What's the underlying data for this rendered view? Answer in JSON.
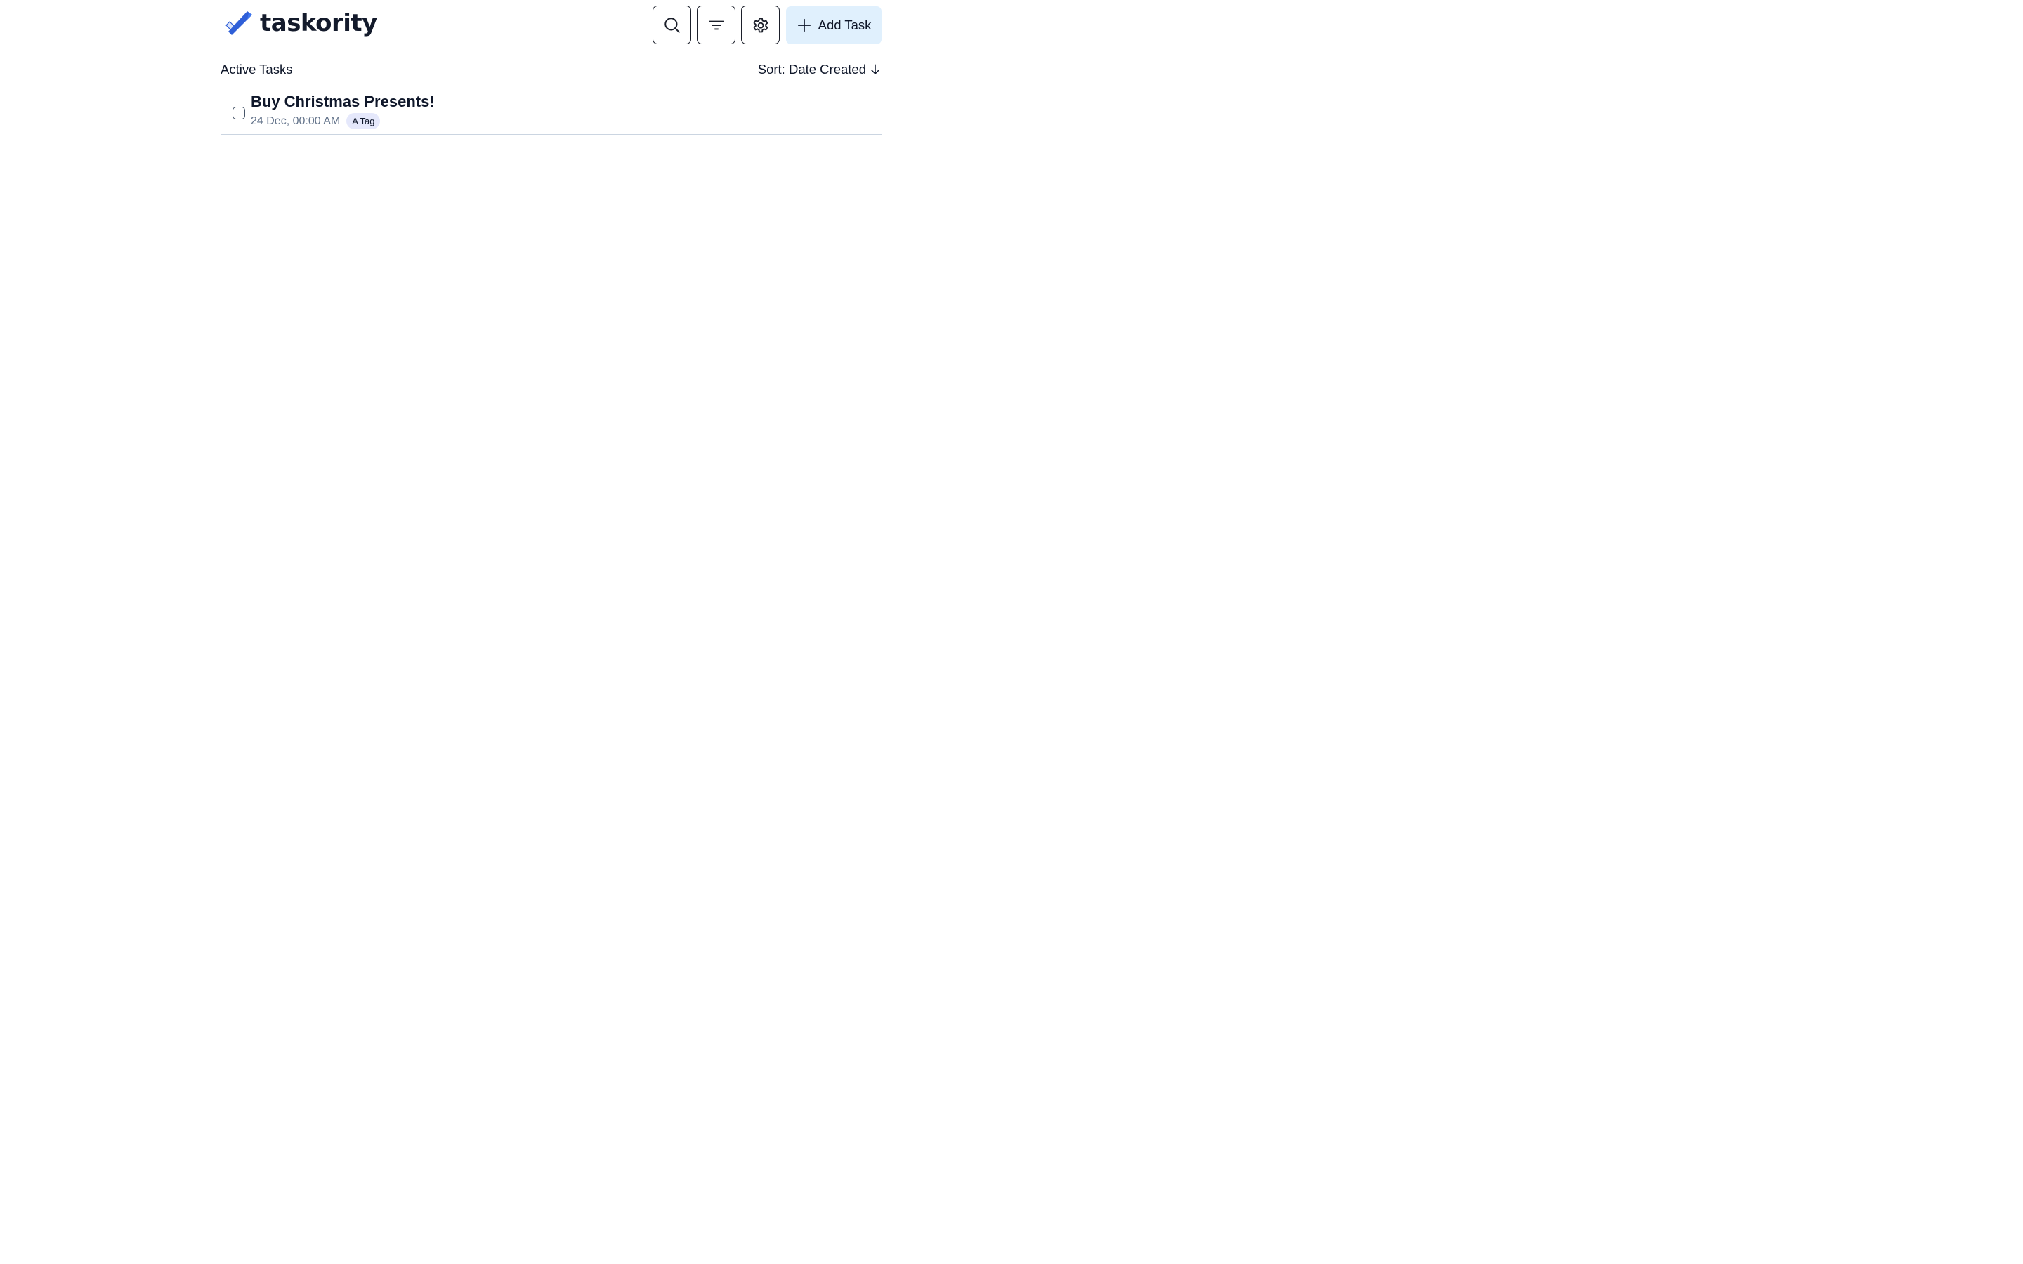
{
  "app": {
    "name": "taskority"
  },
  "header": {
    "add_task_label": "Add Task",
    "icons": {
      "search": "search-icon",
      "filter": "filter-icon",
      "settings": "gear-icon",
      "add": "plus-icon"
    }
  },
  "list": {
    "title": "Active Tasks",
    "sort_label": "Sort: Date Created",
    "sort_direction_icon": "arrow-down-icon"
  },
  "tasks": [
    {
      "title": "Buy Christmas Presents!",
      "date": "24 Dec, 00:00 AM",
      "tags": [
        "A Tag"
      ],
      "completed": false
    }
  ],
  "colors": {
    "accent": "#2f5fd8",
    "add_button_bg": "#e0f0fd",
    "tag_bg": "#e5e8fb",
    "muted_text": "#64748b",
    "border": "#cbd5e1"
  }
}
